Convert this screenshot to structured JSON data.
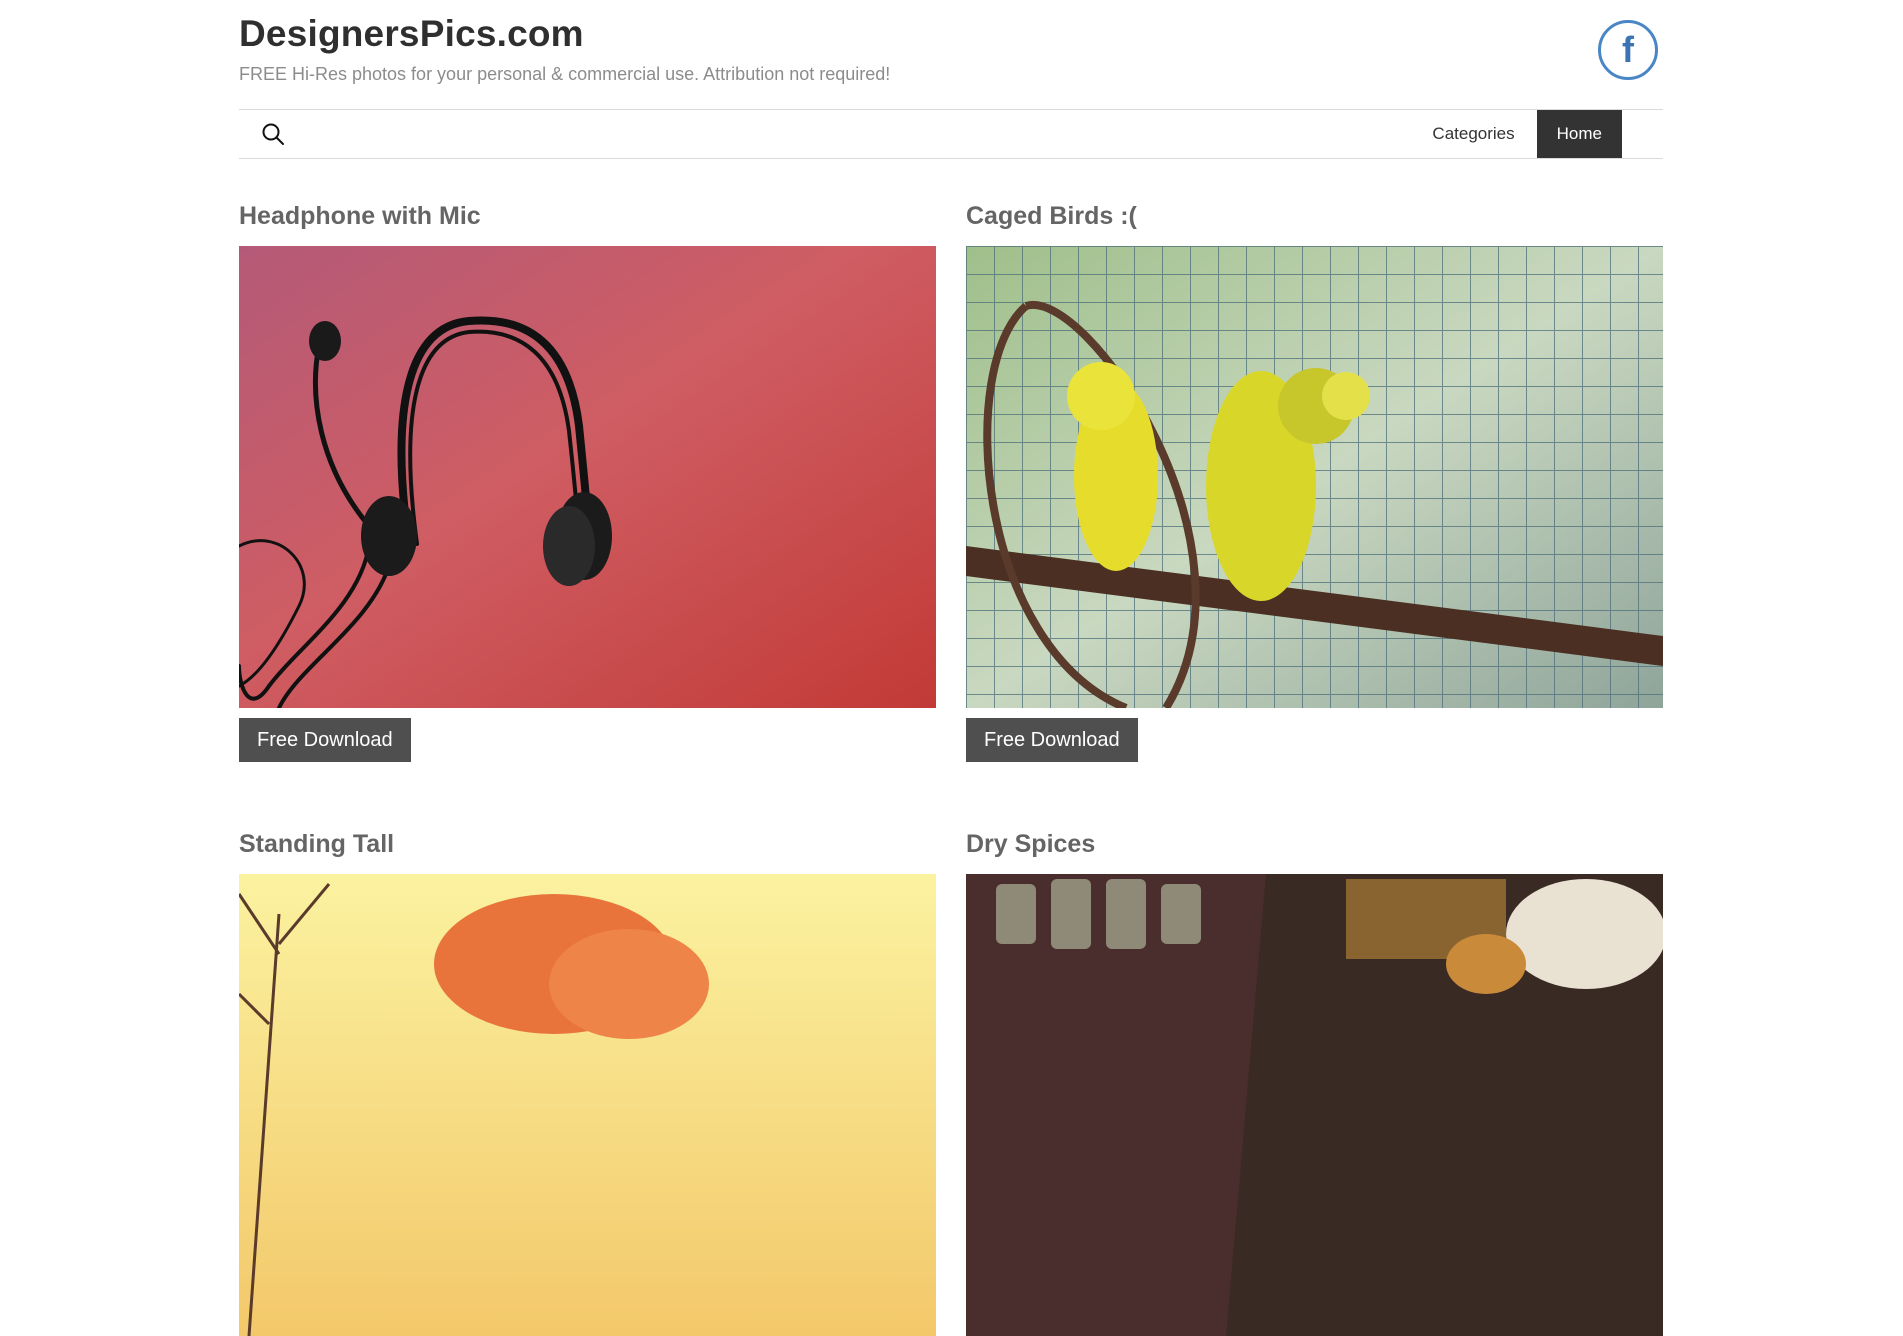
{
  "site": {
    "title": "DesignersPics.com",
    "tagline": "FREE Hi-Res photos for your personal & commercial use. Attribution not required!",
    "facebook_icon": "f"
  },
  "nav": {
    "items": [
      {
        "label": "Categories"
      },
      {
        "label": "Home"
      }
    ],
    "active": "Home"
  },
  "posts": [
    {
      "title": "Headphone with Mic",
      "button": "Free Download"
    },
    {
      "title": "Caged Birds :(",
      "button": "Free Download"
    },
    {
      "title": "Standing Tall"
    },
    {
      "title": "Dry Spices"
    }
  ],
  "colors": {
    "dark": "#333333",
    "button": "#4f4f4f",
    "facebook": "#4a86c5"
  }
}
